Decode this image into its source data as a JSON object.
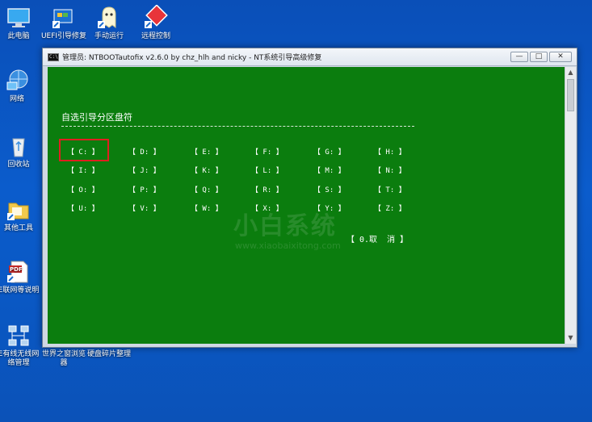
{
  "desktop": {
    "icons": [
      {
        "label": "此电脑",
        "icon": "computer-icon"
      },
      {
        "label": "UEFI引导修复",
        "icon": "uefi-repair-icon"
      },
      {
        "label": "手动运行",
        "icon": "ghost-icon"
      },
      {
        "label": "远程控制",
        "icon": "remote-control-icon"
      },
      {
        "label": "网络",
        "icon": "network-icon"
      },
      {
        "label": "回收站",
        "icon": "recycle-bin-icon"
      },
      {
        "label": "其他工具",
        "icon": "folder-icon"
      },
      {
        "label": "E联网等说明",
        "icon": "pdf-icon"
      },
      {
        "label": "E有线无线网络管理",
        "icon": "network-manager-icon"
      },
      {
        "label": "世界之窗浏览器",
        "icon": "browser-icon"
      },
      {
        "label": "硬盘碎片整理",
        "icon": "defrag-icon"
      }
    ]
  },
  "window": {
    "title": "管理员:  NTBOOTautofix v2.6.0 by chz_hlh and nicky - NT系统引导高级修复",
    "minimize": "—",
    "maximize": "□",
    "close": "✕"
  },
  "console": {
    "heading": "自选引导分区盘符",
    "drives": [
      "【 C: 】",
      "【 D: 】",
      "【 E: 】",
      "【 F: 】",
      "【 G: 】",
      "【 H: 】",
      "【 I: 】",
      "【 J: 】",
      "【 K: 】",
      "【 L: 】",
      "【 M: 】",
      "【 N: 】",
      "【 O: 】",
      "【 P: 】",
      "【 Q: 】",
      "【 R: 】",
      "【 S: 】",
      "【 T: 】",
      "【 U: 】",
      "【 V: 】",
      "【 W: 】",
      "【 X: 】",
      "【 Y: 】",
      "【 Z: 】"
    ],
    "cancel": "【 0.取  消 】",
    "selected_drive": "C:"
  },
  "watermark": {
    "brand": "小白系统",
    "url": "www.xiaobaixitong.com"
  },
  "colors": {
    "console_bg": "#0b7d0e",
    "highlight": "#e01f1f",
    "desktop_bg": "#0b5ccc"
  }
}
